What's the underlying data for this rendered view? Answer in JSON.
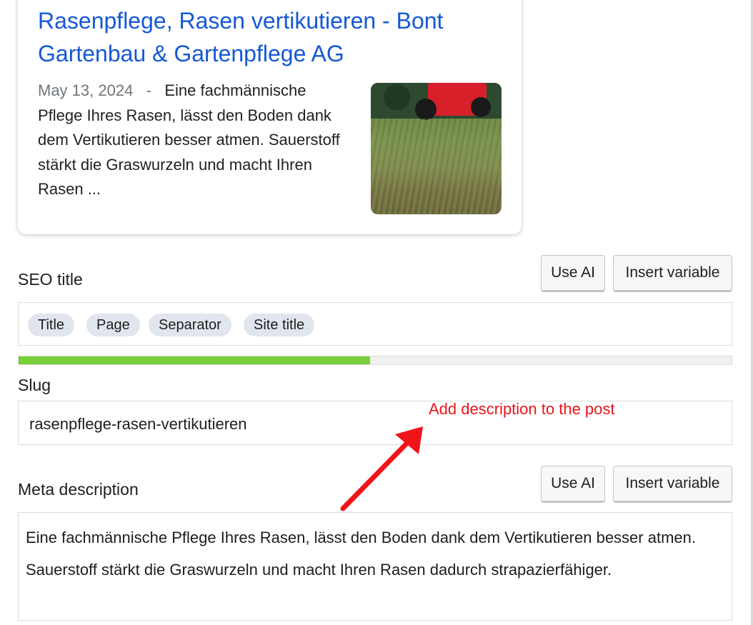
{
  "snippet": {
    "title": "Rasenpflege, Rasen vertikutieren - Bont Gartenbau & Gartenpflege AG",
    "date": "May 13, 2024",
    "separator": "-",
    "description": "Eine fachmännische Pflege Ihres Rasen, lässt den Boden dank dem Vertikutieren besser atmen. Sauerstoff stärkt die Graswurzeln und macht Ihren Rasen ...",
    "thumbnail_icon": "lawn-scarifier-photo"
  },
  "seo_title": {
    "label": "SEO title",
    "use_ai_label": "Use AI",
    "insert_variable_label": "Insert variable",
    "variables": [
      "Title",
      "Page",
      "Separator",
      "Site title"
    ],
    "progress_fraction": 0.493,
    "progress_color": "#7ad03a"
  },
  "slug": {
    "label": "Slug",
    "value": "rasenpflege-rasen-vertikutieren"
  },
  "annotation": {
    "text": "Add description to the post",
    "color": "#e8151b"
  },
  "meta_description": {
    "label": "Meta description",
    "use_ai_label": "Use AI",
    "insert_variable_label": "Insert variable",
    "value": "Eine fachmännische Pflege Ihres Rasen, lässt den Boden dank dem Vertikutieren besser atmen. Sauerstoff stärkt die Graswurzeln und macht Ihren Rasen dadurch strapazierfähiger."
  }
}
